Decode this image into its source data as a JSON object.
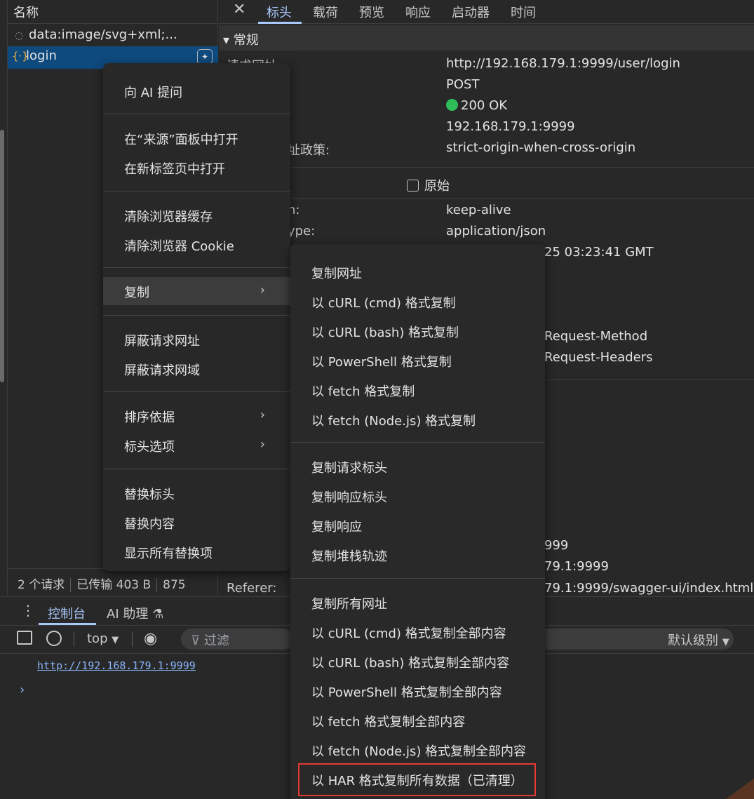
{
  "network_list": {
    "header": "名称",
    "rows": [
      {
        "icon": "loading-icon",
        "name": "data:image/svg+xml;..."
      },
      {
        "icon": "json-icon",
        "name": "login"
      }
    ],
    "status": {
      "requests": "2 个请求",
      "transferred": "已传输 403 B",
      "size": "875"
    }
  },
  "detail_tabs": [
    "标头",
    "载荷",
    "预览",
    "响应",
    "启动器",
    "时间"
  ],
  "general": {
    "section_title": "常规",
    "rows": [
      {
        "key": "请求网址:",
        "value": "http://192.168.179.1:9999/user/login"
      },
      {
        "key": "",
        "value": "POST"
      },
      {
        "key": "",
        "value": "200 OK"
      },
      {
        "key": "",
        "value": "192.168.179.1:9999"
      },
      {
        "key": "址政策:",
        "value": "strict-origin-when-cross-origin"
      }
    ]
  },
  "response_headers": {
    "raw_label": "原始",
    "rows": [
      {
        "key": "n:",
        "value": "keep-alive"
      },
      {
        "key": "ype:",
        "value": "application/json"
      },
      {
        "key": "",
        "value": "25 03:23:41 GMT"
      },
      {
        "key": "",
        "value": "Request-Method"
      },
      {
        "key": "",
        "value": "Request-Headers"
      }
    ]
  },
  "request_headers": {
    "rows": [
      {
        "key": "",
        "value": "999"
      },
      {
        "key": "",
        "value": "79.1:9999"
      },
      {
        "key": "Referer:",
        "value": "79.1:9999/swagger-ui/index.html"
      }
    ]
  },
  "context_menu": {
    "items": [
      {
        "label": "向 AI 提问"
      },
      {
        "label": "在“来源”面板中打开"
      },
      {
        "label": "在新标签页中打开"
      },
      {
        "label": "清除浏览器缓存"
      },
      {
        "label": "清除浏览器 Cookie"
      },
      {
        "label": "复制",
        "submenu": true,
        "highlighted": true
      },
      {
        "label": "屏蔽请求网址"
      },
      {
        "label": "屏蔽请求网域"
      },
      {
        "label": "排序依据",
        "submenu": true
      },
      {
        "label": "标头选项",
        "submenu": true
      },
      {
        "label": "替换标头"
      },
      {
        "label": "替换内容"
      },
      {
        "label": "显示所有替换项"
      }
    ]
  },
  "copy_submenu": {
    "items": [
      "复制网址",
      "以 cURL (cmd) 格式复制",
      "以 cURL (bash) 格式复制",
      "以 PowerShell 格式复制",
      "以 fetch 格式复制",
      "以 fetch (Node.js) 格式复制",
      "复制请求标头",
      "复制响应标头",
      "复制响应",
      "复制堆栈轨迹",
      "复制所有网址",
      "以 cURL (cmd) 格式复制全部内容",
      "以 cURL (bash) 格式复制全部内容",
      "以 PowerShell 格式复制全部内容",
      "以 fetch 格式复制全部内容",
      "以 fetch (Node.js) 格式复制全部内容",
      "以 HAR 格式复制所有数据（已清理）"
    ],
    "highlighted_item": "以 HAR 格式复制所有数据（已清理）",
    "highlight_color": "#e53935"
  },
  "drawer": {
    "tabs": [
      "控制台",
      "AI 助理"
    ],
    "context": "top",
    "filter_placeholder": "过滤",
    "level": "默认级别",
    "console_output": "http://192.168.179.1:9999",
    "prompt": "›"
  },
  "colors": {
    "accent": "#a8c7fa",
    "selection": "#0e4a7e",
    "status_ok": "#2ebd59"
  }
}
